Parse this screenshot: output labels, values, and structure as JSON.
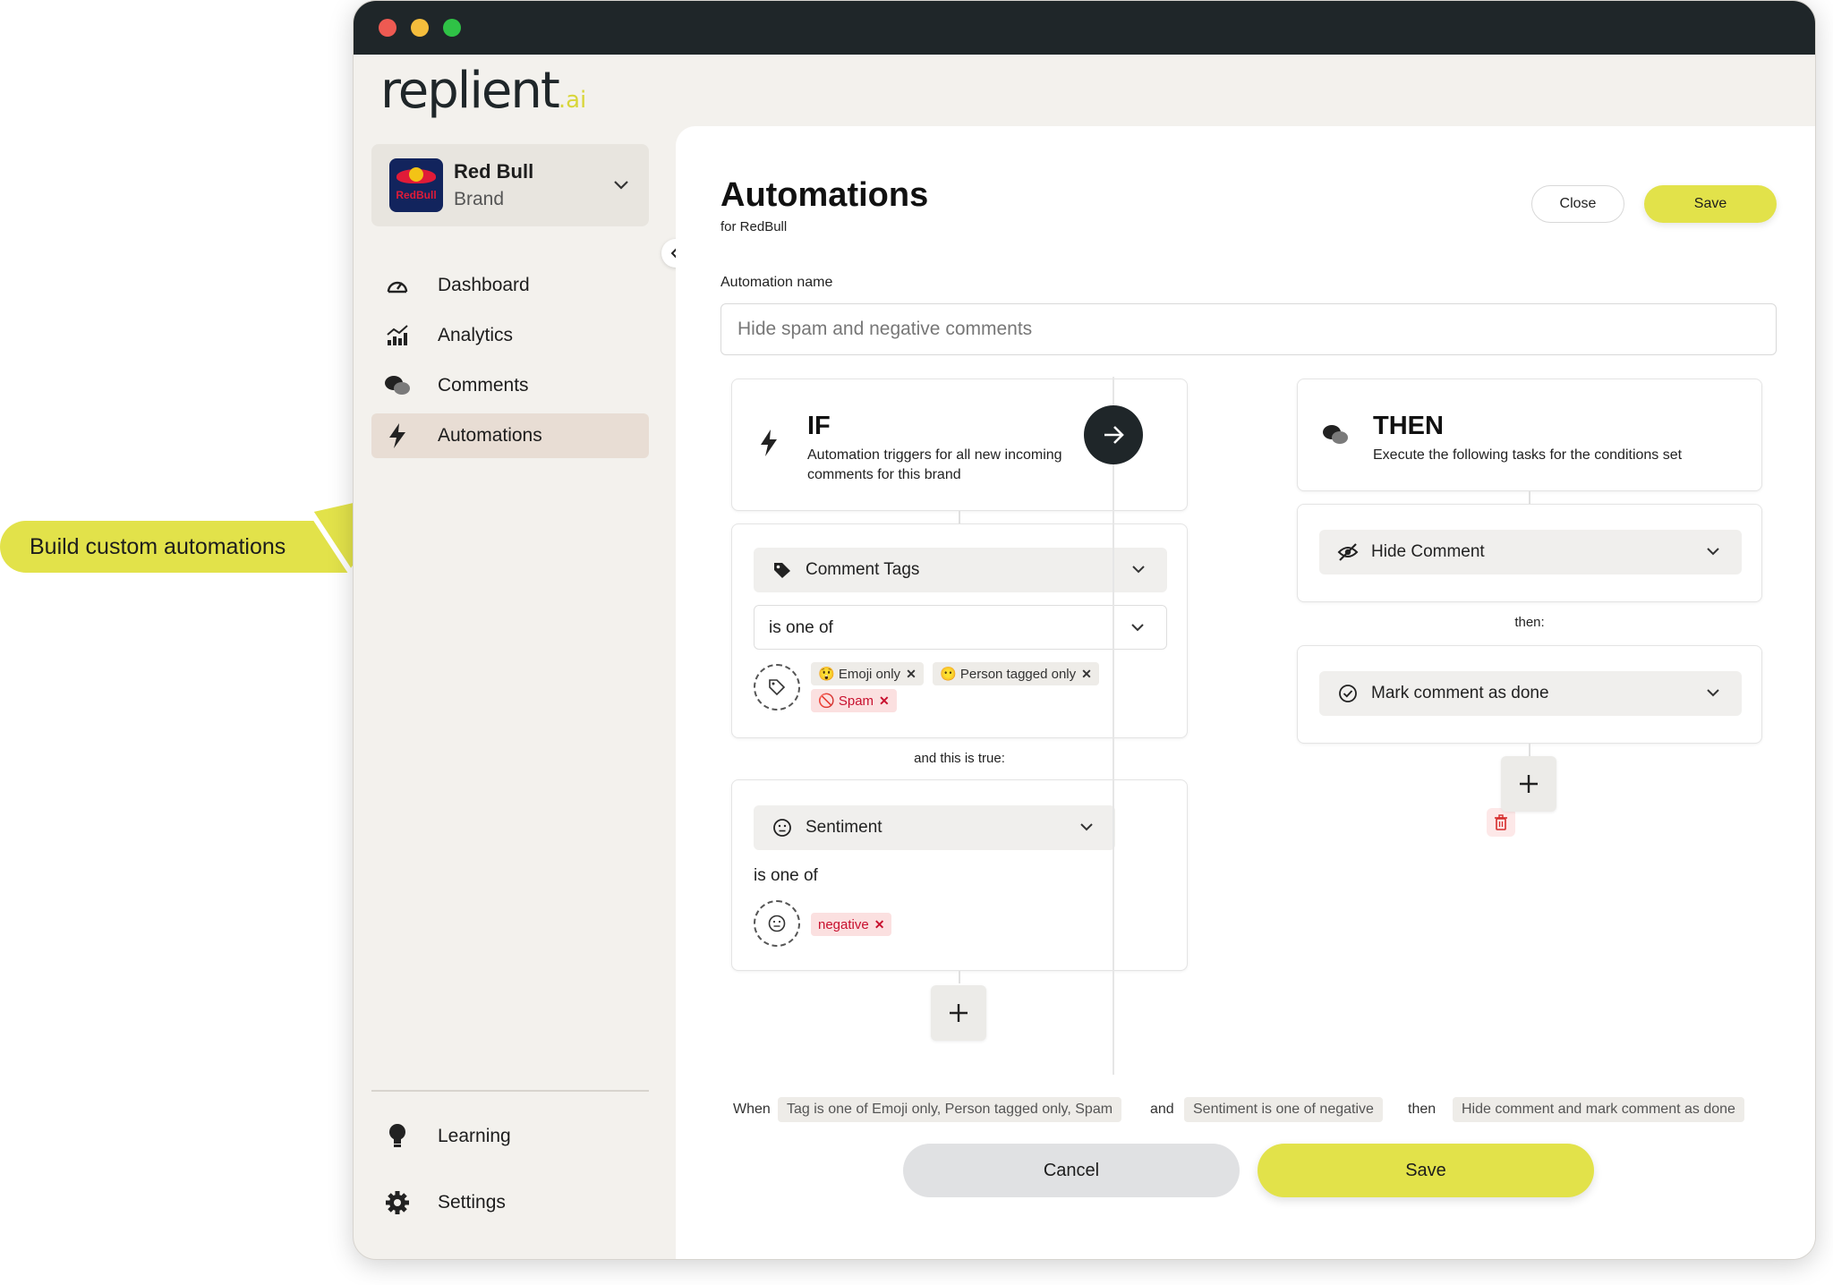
{
  "app": {
    "logo_text": "replient",
    "logo_suffix": ".ai",
    "window_controls": [
      "close-dot",
      "minimize-dot",
      "maximize-dot"
    ]
  },
  "brand": {
    "name": "Red Bull",
    "type": "Brand",
    "logo_text": "RedBull"
  },
  "sidebar": {
    "items": [
      {
        "label": "Dashboard",
        "icon": "speedometer-icon"
      },
      {
        "label": "Analytics",
        "icon": "bar-chart-icon"
      },
      {
        "label": "Comments",
        "icon": "chat-bubbles-icon"
      },
      {
        "label": "Automations",
        "icon": "lightning-icon",
        "active": true
      }
    ],
    "bottom_items": [
      {
        "label": "Learning",
        "icon": "lightbulb-icon"
      },
      {
        "label": "Settings",
        "icon": "gear-icon"
      }
    ]
  },
  "header": {
    "title": "Automations",
    "subtitle": "for RedBull",
    "close_label": "Close",
    "save_label": "Save"
  },
  "form": {
    "name_label": "Automation name",
    "name_placeholder": "Hide spam and negative comments"
  },
  "if_block": {
    "title": "IF",
    "description_line1": "Automation triggers for all new incoming",
    "description_line2": "comments for this brand",
    "condition1": {
      "field": "Comment Tags",
      "operator": "is one of",
      "chips": [
        {
          "label": "Emoji only",
          "emoji": "😲"
        },
        {
          "label": "Person tagged only",
          "emoji": "😶"
        },
        {
          "label": "Spam",
          "emoji": "🚫"
        }
      ]
    },
    "and_label": "and this is true:",
    "condition2": {
      "field": "Sentiment",
      "operator": "is one of",
      "chips": [
        {
          "label": "negative"
        }
      ]
    }
  },
  "then_block": {
    "title": "THEN",
    "description": "Execute the following tasks for the conditions set",
    "action1": "Hide Comment",
    "then_label": "then:",
    "action2": "Mark comment as done"
  },
  "summary": {
    "when": "When",
    "tag_rule": "Tag is one of Emoji only, Person tagged only, Spam",
    "and": "and",
    "sentiment_rule": "Sentiment is one of negative",
    "then": "then",
    "action_rule": "Hide comment and mark comment as done"
  },
  "footer": {
    "cancel_label": "Cancel",
    "save_label": "Save"
  },
  "callout": {
    "text": "Build custom automations"
  },
  "colors": {
    "accent": "#e2e24a",
    "dark": "#1f2629",
    "sidebar_bg": "#f3f1ed",
    "active_nav": "#e8ddd4",
    "danger": "#c8102e"
  }
}
